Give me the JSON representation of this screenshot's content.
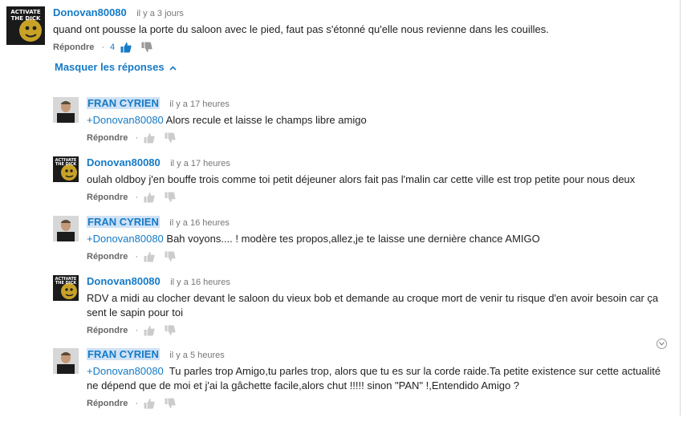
{
  "labels": {
    "reply": "Répondre",
    "hide_replies": "Masquer les réponses"
  },
  "icons": {
    "like": "thumbs-up-icon",
    "dislike": "thumbs-down-icon",
    "options": "chevron-down-icon",
    "collapse": "chevron-up-icon"
  },
  "colors": {
    "link": "#167ac6",
    "highlight": "#cfe2f6",
    "meta": "#777777"
  },
  "top_comment": {
    "author": "Donovan80080",
    "time": "il y a 3 jours",
    "text": "quand ont pousse la porte du saloon avec le pied, faut pas s'étonné qu'elle nous revienne dans les couilles.",
    "like_count": "4",
    "avatar_text_line1": "ACTIVATE",
    "avatar_text_line2": "THE DICK"
  },
  "replies": [
    {
      "author": "FRAN CYRIEN",
      "time": "il y a 17 heures",
      "mention": "+Donovan80080",
      "text": " Alors recule et laisse le champs libre amigo"
    },
    {
      "author": "Donovan80080",
      "time": "il y a 17 heures",
      "text": "oulah oldboy j'en bouffe trois comme toi petit déjeuner alors fait pas l'malin car cette ville est trop petite pour nous deux"
    },
    {
      "author": "FRAN CYRIEN",
      "time": "il y a 16 heures",
      "mention": "+Donovan80080",
      "text": " Bah voyons.... ! modère tes propos,allez,je te laisse une dernière chance AMIGO"
    },
    {
      "author": "Donovan80080",
      "time": "il y a 16 heures",
      "text": "RDV a midi au clocher devant le saloon du vieux bob et demande au croque mort de venir tu risque d'en avoir besoin car ça sent le sapin pour toi"
    },
    {
      "author": "FRAN CYRIEN",
      "time": "il y a 5 heures",
      "mention": "+Donovan80080",
      "text": "  Tu parles trop Amigo,tu parles trop, alors que tu es sur la corde raide.Ta petite existence sur cette actualité ne dépend que de moi et j'ai la gâchette facile,alors chut !!!!! sinon \"PAN\" !,Entendido Amigo ?"
    }
  ]
}
